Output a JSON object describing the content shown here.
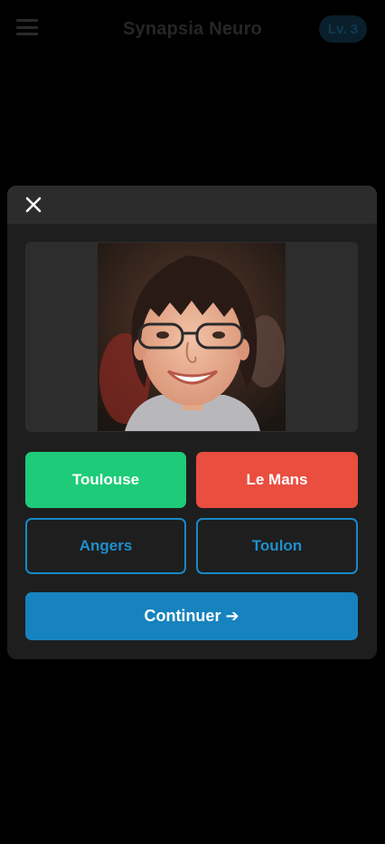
{
  "header": {
    "title": "Synapsia Neuro",
    "level": "Lv. 3",
    "menu_icon": "hamburger-menu-icon"
  },
  "modal": {
    "close_icon": "close-icon",
    "photo": {
      "subject": "face-photo"
    },
    "answers": [
      {
        "label": "Toulouse",
        "state": "correct"
      },
      {
        "label": "Le Mans",
        "state": "wrong"
      },
      {
        "label": "Angers",
        "state": "neutral"
      },
      {
        "label": "Toulon",
        "state": "neutral"
      }
    ],
    "continue_label": "Continuer ➔"
  },
  "colors": {
    "correct": "#1ecb78",
    "wrong": "#e94e3f",
    "accent": "#1682be",
    "background": "#000000",
    "modal": "#1e1e1e"
  }
}
